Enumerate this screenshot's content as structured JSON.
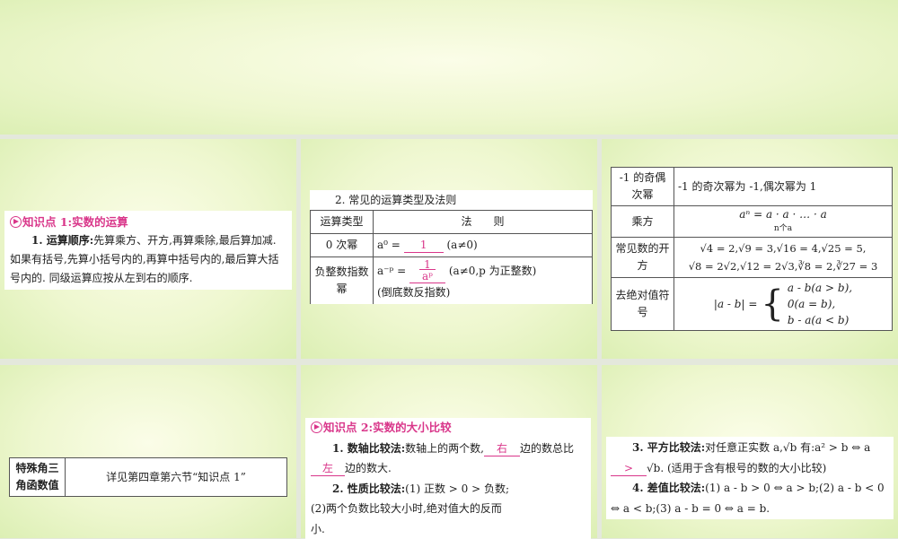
{
  "kp1": {
    "title": "知识点 1:实数的运算",
    "item_label": "1. 运算顺序:",
    "item_text": "先算乘方、开方,再算乘除,最后算加减. 如果有括号,先算小括号内的,再算中括号内的,最后算大括号内的. 同级运算应按从左到右的顺序."
  },
  "table1": {
    "title": "2. 常见的运算类型及法则",
    "header": [
      "运算类型",
      "法　　则"
    ],
    "row0": {
      "type": "0 次幂",
      "lhs": "a⁰ =",
      "answer": "1",
      "cond": "(a≠0)"
    },
    "row1": {
      "type": "负整数指数幂",
      "lhs": "a⁻ᵖ =",
      "answer_num": "1",
      "answer_den": "aᵖ",
      "cond": "(a≠0,p 为正整数)",
      "note": "(倒底数反指数)"
    }
  },
  "table2": {
    "rows": [
      {
        "type": "-1 的奇偶次幂",
        "rule": "-1 的奇次幂为 -1,偶次幂为 1"
      },
      {
        "type": "乘方",
        "rule": "aⁿ = a · a · … · a",
        "sub": "n个a"
      },
      {
        "type": "常见数的开方",
        "rule": "√4 = 2,√9 = 3,√16 = 4,√25 = 5,",
        "rule2": "√8 = 2√2,√12 = 2√3,∛8 = 2,∛27 = 3"
      },
      {
        "type": "去绝对值符号",
        "lhs": "|a - b| =",
        "cases": [
          "a - b(a > b),",
          "0(a = b),",
          "b - a(a < b)"
        ]
      }
    ]
  },
  "table3": {
    "type": "特殊角三角函数值",
    "rule": "详见第四章第六节“知识点 1”"
  },
  "kp2": {
    "title": "知识点 2:实数的大小比较",
    "m1_label": "1. 数轴比较法:",
    "m1_a": "数轴上的两个数,",
    "m1_ans1": "右",
    "m1_b": "边的数总比",
    "m1_ans2": "左",
    "m1_c": "边的数大.",
    "m2_label": "2. 性质比较法:",
    "m2_text": "(1) 正数 > 0 > 负数;(2)两个负数比较大小时,绝对值大的反而小."
  },
  "kp3": {
    "m3_label": "3. 平方比较法:",
    "m3_a": "对任意正实数 a,√b 有:a² > b ⇔ a",
    "m3_ans": ">",
    "m3_b": "√b. (适用于含有根号的数的大小比较)",
    "m4_label": "4. 差值比较法:",
    "m4_text": "(1) a - b > 0 ⇔ a > b;(2) a - b < 0 ⇔ a < b;(3) a - b = 0 ⇔ a = b."
  }
}
